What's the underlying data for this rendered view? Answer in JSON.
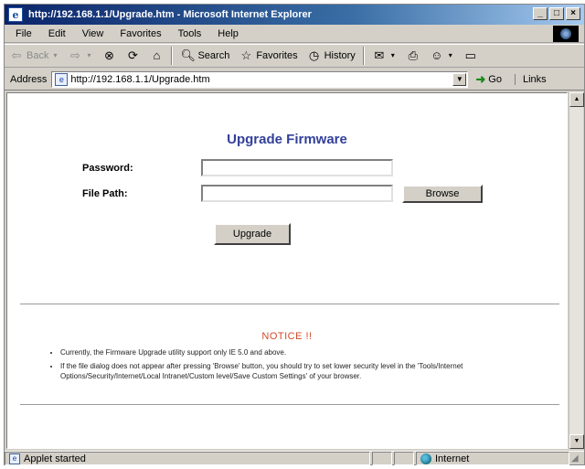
{
  "window": {
    "title": "http://192.168.1.1/Upgrade.htm - Microsoft Internet Explorer",
    "controls": [
      "_",
      "□",
      "×"
    ]
  },
  "menu": [
    "File",
    "Edit",
    "View",
    "Favorites",
    "Tools",
    "Help"
  ],
  "toolbar": {
    "back": "Back",
    "search": "Search",
    "favorites": "Favorites",
    "history": "History"
  },
  "address": {
    "label": "Address",
    "url": "http://192.168.1.1/Upgrade.htm",
    "go": "Go",
    "links": "Links"
  },
  "page": {
    "title": "Upgrade Firmware",
    "password_label": "Password:",
    "password_value": "",
    "filepath_label": "File Path:",
    "filepath_value": "",
    "browse_label": "Browse",
    "upgrade_label": "Upgrade",
    "notice_title": "NOTICE !!",
    "notices": [
      "Currently, the Firmware Upgrade utility support only IE 5.0 and above.",
      "If the file dialog does not appear after pressing 'Browse' button, you should try to set lower security level in the 'Tools/Internet Options/Security/Internet/Local Intranet/Custom level/Save Custom Settings' of your browser."
    ]
  },
  "status": {
    "text": "Applet started",
    "zone": "Internet"
  },
  "colors": {
    "title_blue": "#33409a",
    "notice_red": "#d24a2a"
  }
}
